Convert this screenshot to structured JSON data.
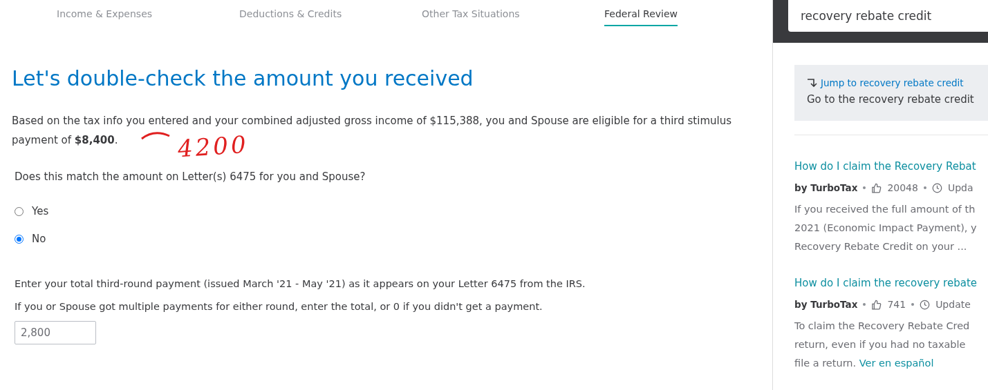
{
  "tabs": [
    {
      "label": "Income & Expenses",
      "selected": false
    },
    {
      "label": "Deductions & Credits",
      "selected": false
    },
    {
      "label": "Other Tax Situations",
      "selected": false
    },
    {
      "label": "Federal Review",
      "selected": true
    }
  ],
  "heading": "Let's double-check the amount you received",
  "intro": {
    "text": "Based on the tax info you entered and your combined adjusted gross income of $115,388, you and Spouse are eligible for a third stimulus payment of ",
    "amount": "$8,400",
    "end": "."
  },
  "annotation": {
    "text": "4200"
  },
  "question": "Does this match the amount on Letter(s) 6475 for you and Spouse?",
  "options": [
    {
      "label": "Yes",
      "selected": false
    },
    {
      "label": "No",
      "selected": true
    }
  ],
  "instructions": [
    "Enter your total third-round payment (issued March '21 - May '21) as it appears on your Letter 6475 from the IRS.",
    "If you or Spouse got multiple payments for either round, enter the total, or 0 if you didn't get a payment."
  ],
  "payment_field": {
    "value": "2,800"
  },
  "sidebar": {
    "search": {
      "value": "recovery rebate credit"
    },
    "jump": {
      "link": "Jump to recovery rebate credit",
      "text": "Go to the recovery rebate credit"
    },
    "articles": [
      {
        "title": "How do I claim the Recovery Rebat",
        "author": "by TurboTax",
        "likes": "20048",
        "updated": "Upda",
        "snippet": [
          "If you received the full amount of th",
          "2021 (Economic Impact Payment), y",
          "Recovery Rebate Credit on your ..."
        ]
      },
      {
        "title": "How do I claim the recovery rebate",
        "author": "by TurboTax",
        "likes": "741",
        "updated": "Update",
        "snippet": [
          "To claim the Recovery Rebate Cred",
          "return, even if you had no taxable"
        ],
        "tail": "file a return.",
        "link": "Ver en español"
      }
    ]
  }
}
